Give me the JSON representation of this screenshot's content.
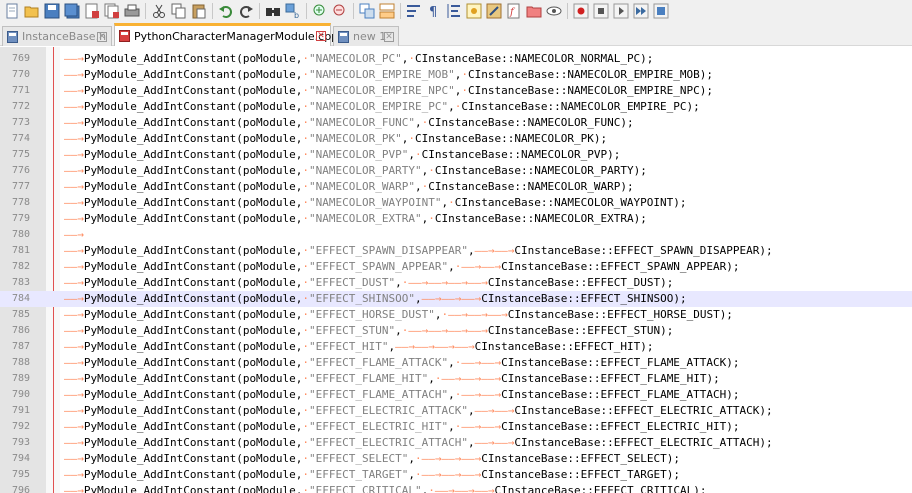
{
  "toolbar": {
    "icons": [
      "new-file",
      "open-file",
      "save",
      "save-all",
      "close",
      "close-all",
      "print",
      "cut",
      "copy",
      "paste",
      "undo",
      "redo",
      "find",
      "replace",
      "zoom-in",
      "zoom-out",
      "sync-v",
      "sync-h",
      "wrap",
      "show-all-chars",
      "indent-guide",
      "udl",
      "doc-map",
      "function-list",
      "folder-workspace",
      "monitoring",
      "record-macro",
      "stop-record",
      "play-macro",
      "run-macro-multiple",
      "save-macro"
    ]
  },
  "tabs": [
    {
      "label": "InstanceBase.h",
      "active": false
    },
    {
      "label": "PythonCharacterManagerModule.cpp",
      "active": true
    },
    {
      "label": "new 1",
      "active": false
    }
  ],
  "editor": {
    "current_line": "784",
    "lines": [
      {
        "num": "769",
        "seg": [
          [
            "t",
            ""
          ],
          [
            "f",
            "PyModule_AddIntConstant(poModule, "
          ],
          [
            "s",
            "\"NAMECOLOR_PC\""
          ],
          [
            "f",
            ", CInstanceBase::NAMECOLOR_NORMAL_PC);"
          ]
        ]
      },
      {
        "num": "770",
        "seg": [
          [
            "t",
            ""
          ],
          [
            "f",
            "PyModule_AddIntConstant(poModule, "
          ],
          [
            "s",
            "\"NAMECOLOR_EMPIRE_MOB\""
          ],
          [
            "f",
            ", CInstanceBase::NAMECOLOR_EMPIRE_MOB);"
          ]
        ]
      },
      {
        "num": "771",
        "seg": [
          [
            "t",
            ""
          ],
          [
            "f",
            "PyModule_AddIntConstant(poModule, "
          ],
          [
            "s",
            "\"NAMECOLOR_EMPIRE_NPC\""
          ],
          [
            "f",
            ", CInstanceBase::NAMECOLOR_EMPIRE_NPC);"
          ]
        ]
      },
      {
        "num": "772",
        "seg": [
          [
            "t",
            ""
          ],
          [
            "f",
            "PyModule_AddIntConstant(poModule, "
          ],
          [
            "s",
            "\"NAMECOLOR_EMPIRE_PC\""
          ],
          [
            "f",
            ", CInstanceBase::NAMECOLOR_EMPIRE_PC);"
          ]
        ]
      },
      {
        "num": "773",
        "seg": [
          [
            "t",
            ""
          ],
          [
            "f",
            "PyModule_AddIntConstant(poModule, "
          ],
          [
            "s",
            "\"NAMECOLOR_FUNC\""
          ],
          [
            "f",
            ", CInstanceBase::NAMECOLOR_FUNC);"
          ]
        ]
      },
      {
        "num": "774",
        "seg": [
          [
            "t",
            ""
          ],
          [
            "f",
            "PyModule_AddIntConstant(poModule, "
          ],
          [
            "s",
            "\"NAMECOLOR_PK\""
          ],
          [
            "f",
            ", CInstanceBase::NAMECOLOR_PK);"
          ]
        ]
      },
      {
        "num": "775",
        "seg": [
          [
            "t",
            ""
          ],
          [
            "f",
            "PyModule_AddIntConstant(poModule, "
          ],
          [
            "s",
            "\"NAMECOLOR_PVP\""
          ],
          [
            "f",
            ", CInstanceBase::NAMECOLOR_PVP);"
          ]
        ]
      },
      {
        "num": "776",
        "seg": [
          [
            "t",
            ""
          ],
          [
            "f",
            "PyModule_AddIntConstant(poModule, "
          ],
          [
            "s",
            "\"NAMECOLOR_PARTY\""
          ],
          [
            "f",
            ", CInstanceBase::NAMECOLOR_PARTY);"
          ]
        ]
      },
      {
        "num": "777",
        "seg": [
          [
            "t",
            ""
          ],
          [
            "f",
            "PyModule_AddIntConstant(poModule, "
          ],
          [
            "s",
            "\"NAMECOLOR_WARP\""
          ],
          [
            "f",
            ", CInstanceBase::NAMECOLOR_WARP);"
          ]
        ]
      },
      {
        "num": "778",
        "seg": [
          [
            "t",
            ""
          ],
          [
            "f",
            "PyModule_AddIntConstant(poModule, "
          ],
          [
            "s",
            "\"NAMECOLOR_WAYPOINT\""
          ],
          [
            "f",
            ", CInstanceBase::NAMECOLOR_WAYPOINT);"
          ]
        ]
      },
      {
        "num": "779",
        "seg": [
          [
            "t",
            ""
          ],
          [
            "f",
            "PyModule_AddIntConstant(poModule, "
          ],
          [
            "s",
            "\"NAMECOLOR_EXTRA\""
          ],
          [
            "f",
            ", CInstanceBase::NAMECOLOR_EXTRA);"
          ]
        ]
      },
      {
        "num": "780",
        "seg": [
          [
            "t",
            ""
          ]
        ]
      },
      {
        "num": "781",
        "seg": [
          [
            "t",
            ""
          ],
          [
            "f",
            "PyModule_AddIntConstant(poModule, "
          ],
          [
            "s",
            "\"EFFECT_SPAWN_DISAPPEAR\""
          ],
          [
            "f",
            ","
          ],
          [
            "t",
            ""
          ],
          [
            "t",
            ""
          ],
          [
            "f",
            "CInstanceBase::EFFECT_SPAWN_DISAPPEAR);"
          ]
        ]
      },
      {
        "num": "782",
        "seg": [
          [
            "t",
            ""
          ],
          [
            "f",
            "PyModule_AddIntConstant(poModule, "
          ],
          [
            "s",
            "\"EFFECT_SPAWN_APPEAR\""
          ],
          [
            "f",
            ", "
          ],
          [
            "t",
            ""
          ],
          [
            "t",
            ""
          ],
          [
            "f",
            "CInstanceBase::EFFECT_SPAWN_APPEAR);"
          ]
        ]
      },
      {
        "num": "783",
        "seg": [
          [
            "t",
            ""
          ],
          [
            "f",
            "PyModule_AddIntConstant(poModule, "
          ],
          [
            "s",
            "\"EFFECT_DUST\""
          ],
          [
            "f",
            ", "
          ],
          [
            "t",
            ""
          ],
          [
            "t",
            ""
          ],
          [
            "t",
            ""
          ],
          [
            "t",
            ""
          ],
          [
            "f",
            "CInstanceBase::EFFECT_DUST);"
          ]
        ]
      },
      {
        "num": "784",
        "seg": [
          [
            "t",
            ""
          ],
          [
            "f",
            "PyModule_AddIntConstant(poModule, "
          ],
          [
            "s",
            "\"EFFECT_SHINSOO\""
          ],
          [
            "f",
            ","
          ],
          [
            "t",
            ""
          ],
          [
            "t",
            ""
          ],
          [
            "t",
            ""
          ],
          [
            "f",
            "CInstanceBase::EFFECT_SHINSOO);"
          ]
        ]
      },
      {
        "num": "785",
        "seg": [
          [
            "t",
            ""
          ],
          [
            "f",
            "PyModule_AddIntConstant(poModule, "
          ],
          [
            "s",
            "\"EFFECT_HORSE_DUST\""
          ],
          [
            "f",
            ", "
          ],
          [
            "t",
            ""
          ],
          [
            "t",
            ""
          ],
          [
            "t",
            ""
          ],
          [
            "f",
            "CInstanceBase::EFFECT_HORSE_DUST);"
          ]
        ]
      },
      {
        "num": "786",
        "seg": [
          [
            "t",
            ""
          ],
          [
            "f",
            "PyModule_AddIntConstant(poModule, "
          ],
          [
            "s",
            "\"EFFECT_STUN\""
          ],
          [
            "f",
            ", "
          ],
          [
            "t",
            ""
          ],
          [
            "t",
            ""
          ],
          [
            "t",
            ""
          ],
          [
            "t",
            ""
          ],
          [
            "f",
            "CInstanceBase::EFFECT_STUN);"
          ]
        ]
      },
      {
        "num": "787",
        "seg": [
          [
            "t",
            ""
          ],
          [
            "f",
            "PyModule_AddIntConstant(poModule, "
          ],
          [
            "s",
            "\"EFFECT_HIT\""
          ],
          [
            "f",
            ","
          ],
          [
            "t",
            ""
          ],
          [
            "t",
            ""
          ],
          [
            "t",
            ""
          ],
          [
            "t",
            ""
          ],
          [
            "f",
            "CInstanceBase::EFFECT_HIT);"
          ]
        ]
      },
      {
        "num": "788",
        "seg": [
          [
            "t",
            ""
          ],
          [
            "f",
            "PyModule_AddIntConstant(poModule, "
          ],
          [
            "s",
            "\"EFFECT_FLAME_ATTACK\""
          ],
          [
            "f",
            ", "
          ],
          [
            "t",
            ""
          ],
          [
            "t",
            ""
          ],
          [
            "f",
            "CInstanceBase::EFFECT_FLAME_ATTACK);"
          ]
        ]
      },
      {
        "num": "789",
        "seg": [
          [
            "t",
            ""
          ],
          [
            "f",
            "PyModule_AddIntConstant(poModule, "
          ],
          [
            "s",
            "\"EFFECT_FLAME_HIT\""
          ],
          [
            "f",
            ", "
          ],
          [
            "t",
            ""
          ],
          [
            "t",
            ""
          ],
          [
            "t",
            ""
          ],
          [
            "f",
            "CInstanceBase::EFFECT_FLAME_HIT);"
          ]
        ]
      },
      {
        "num": "790",
        "seg": [
          [
            "t",
            ""
          ],
          [
            "f",
            "PyModule_AddIntConstant(poModule, "
          ],
          [
            "s",
            "\"EFFECT_FLAME_ATTACH\""
          ],
          [
            "f",
            ", "
          ],
          [
            "t",
            ""
          ],
          [
            "t",
            ""
          ],
          [
            "f",
            "CInstanceBase::EFFECT_FLAME_ATTACH);"
          ]
        ]
      },
      {
        "num": "791",
        "seg": [
          [
            "t",
            ""
          ],
          [
            "f",
            "PyModule_AddIntConstant(poModule, "
          ],
          [
            "s",
            "\"EFFECT_ELECTRIC_ATTACK\""
          ],
          [
            "f",
            ","
          ],
          [
            "t",
            ""
          ],
          [
            "t",
            ""
          ],
          [
            "f",
            "CInstanceBase::EFFECT_ELECTRIC_ATTACK);"
          ]
        ]
      },
      {
        "num": "792",
        "seg": [
          [
            "t",
            ""
          ],
          [
            "f",
            "PyModule_AddIntConstant(poModule, "
          ],
          [
            "s",
            "\"EFFECT_ELECTRIC_HIT\""
          ],
          [
            "f",
            ", "
          ],
          [
            "t",
            ""
          ],
          [
            "t",
            ""
          ],
          [
            "f",
            "CInstanceBase::EFFECT_ELECTRIC_HIT);"
          ]
        ]
      },
      {
        "num": "793",
        "seg": [
          [
            "t",
            ""
          ],
          [
            "f",
            "PyModule_AddIntConstant(poModule, "
          ],
          [
            "s",
            "\"EFFECT_ELECTRIC_ATTACH\""
          ],
          [
            "f",
            ","
          ],
          [
            "t",
            ""
          ],
          [
            "t",
            ""
          ],
          [
            "f",
            "CInstanceBase::EFFECT_ELECTRIC_ATTACH);"
          ]
        ]
      },
      {
        "num": "794",
        "seg": [
          [
            "t",
            ""
          ],
          [
            "f",
            "PyModule_AddIntConstant(poModule, "
          ],
          [
            "s",
            "\"EFFECT_SELECT\""
          ],
          [
            "f",
            ", "
          ],
          [
            "t",
            ""
          ],
          [
            "t",
            ""
          ],
          [
            "t",
            ""
          ],
          [
            "f",
            "CInstanceBase::EFFECT_SELECT);"
          ]
        ]
      },
      {
        "num": "795",
        "seg": [
          [
            "t",
            ""
          ],
          [
            "f",
            "PyModule_AddIntConstant(poModule, "
          ],
          [
            "s",
            "\"EFFECT_TARGET\""
          ],
          [
            "f",
            ", "
          ],
          [
            "t",
            ""
          ],
          [
            "t",
            ""
          ],
          [
            "t",
            ""
          ],
          [
            "f",
            "CInstanceBase::EFFECT_TARGET);"
          ]
        ]
      },
      {
        "num": "796",
        "seg": [
          [
            "t",
            ""
          ],
          [
            "f",
            "PyModule_AddIntConstant(poModule, "
          ],
          [
            "s",
            "\"EFFECT_CRITICAL\""
          ],
          [
            "f",
            ", "
          ],
          [
            "t",
            ""
          ],
          [
            "t",
            ""
          ],
          [
            "t",
            ""
          ],
          [
            "f",
            "CInstanceBase::EFFECT_CRITICAL);"
          ]
        ]
      }
    ]
  }
}
